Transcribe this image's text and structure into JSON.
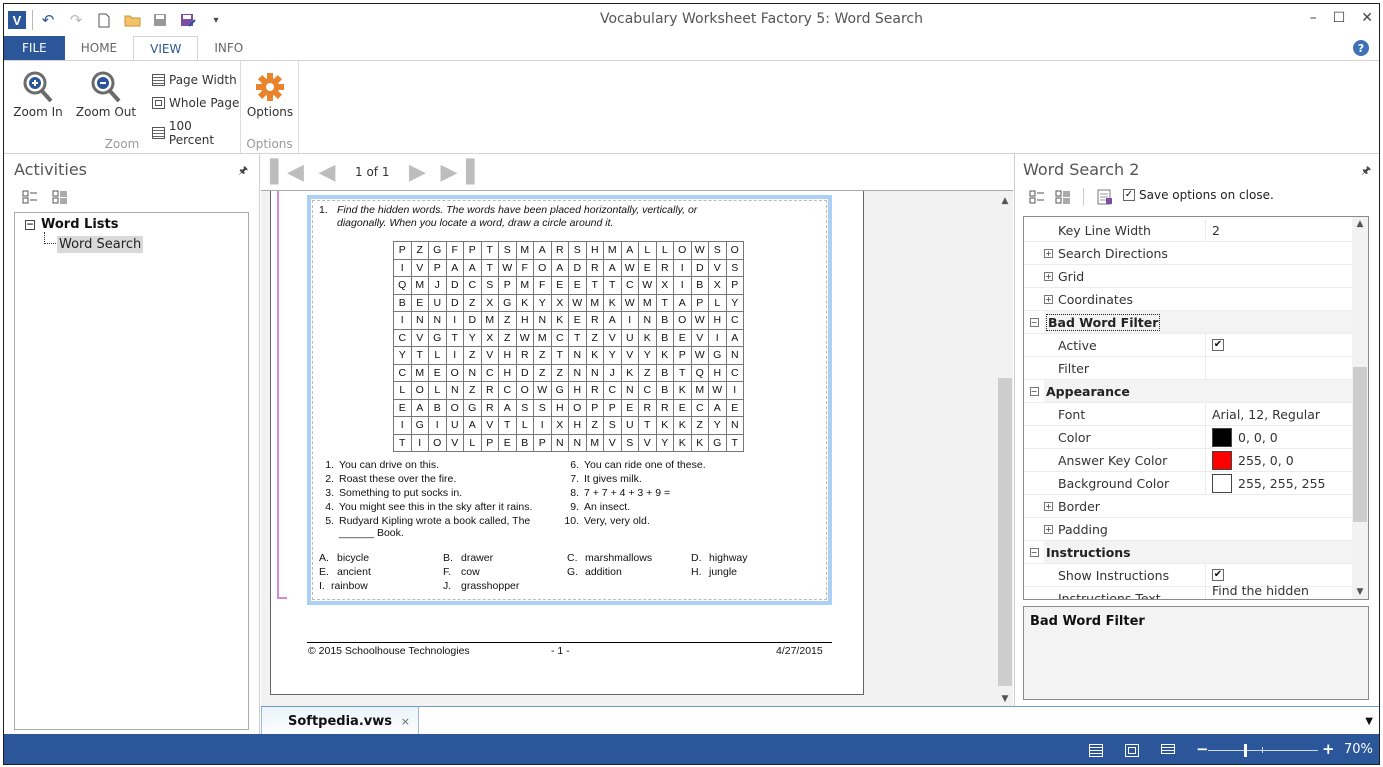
{
  "window": {
    "title": "Vocabulary Worksheet Factory 5: Word Search",
    "logo_letter": "V",
    "controls": {
      "minimize": "–",
      "maximize": "☐",
      "close": "✕"
    },
    "help": "?"
  },
  "quick_access": [
    "undo-icon",
    "redo-icon",
    "new-document-icon",
    "open-folder-icon",
    "save-icon",
    "save-as-icon",
    "customize-dropdown-icon"
  ],
  "ribbon": {
    "tabs": [
      {
        "label": "FILE"
      },
      {
        "label": "HOME"
      },
      {
        "label": "VIEW",
        "active": true
      },
      {
        "label": "INFO"
      }
    ],
    "zoom_group": {
      "label": "Zoom",
      "zoom_in": "Zoom In",
      "zoom_out": "Zoom Out",
      "page_width": "Page Width",
      "whole_page": "Whole Page",
      "hundred_percent": "100 Percent"
    },
    "options_group": {
      "label": "Options",
      "options": "Options"
    }
  },
  "activities": {
    "title": "Activities",
    "tree": {
      "root": "Word Lists",
      "child": "Word Search"
    }
  },
  "document": {
    "page_indicator": "1 of 1",
    "instruction_number": "1.",
    "instruction_line1": "Find the hidden words. The words have been placed horizontally, vertically, or",
    "instruction_line2": "diagonally. When you locate a word, draw a circle around it.",
    "grid": [
      "PZGFPTSMARSHMALLOWSO",
      "IVPAATWFOADRAWERIDVS",
      "QMJDCSPMFEETTCWXIBXP",
      "BEUDZXGKYXWMKWMTAPLY",
      "INNIDMZHNKERAINBOWHC",
      "CVGTYXZWMCTZVUKBEVIA",
      "YTLIZVHRZTNKYVYKPWGN",
      "CMEONCHDZZNNJKZBTQHC",
      "LOLNZRCOWGHRCNCBKMWI",
      "EABOGRASSHOPPERRECAE",
      "IGIUAVTLIXHZSUTKKZYN",
      "TIOVLPEBPNNMVSVYKKGT"
    ],
    "clues": [
      {
        "n": "1.",
        "text": "You can drive on this."
      },
      {
        "n": "2.",
        "text": "Roast these over the fire."
      },
      {
        "n": "3.",
        "text": "Something to put socks in."
      },
      {
        "n": "4.",
        "text": "You might see this in the sky after it rains."
      },
      {
        "n": "5.",
        "text": "Rudyard Kipling wrote a book called, The",
        "text2": "______ Book."
      },
      {
        "n": "6.",
        "text": "You can ride one of these."
      },
      {
        "n": "7.",
        "text": "It gives milk."
      },
      {
        "n": "8.",
        "text": "7 + 7 + 4 + 3 + 9 ="
      },
      {
        "n": "9.",
        "text": "An insect."
      },
      {
        "n": "10.",
        "text": "Very, very old."
      }
    ],
    "answers": [
      {
        "l": "A.",
        "w": "bicycle"
      },
      {
        "l": "B.",
        "w": "drawer"
      },
      {
        "l": "C.",
        "w": "marshmallows"
      },
      {
        "l": "D.",
        "w": "highway"
      },
      {
        "l": "E.",
        "w": "ancient"
      },
      {
        "l": "F.",
        "w": "cow"
      },
      {
        "l": "G.",
        "w": "addition"
      },
      {
        "l": "H.",
        "w": "jungle"
      },
      {
        "l": "I.",
        "w": "rainbow"
      },
      {
        "l": "J.",
        "w": "grasshopper"
      }
    ],
    "footer": {
      "copyright": "© 2015 Schoolhouse Technologies",
      "page": "- 1 -",
      "date": "4/27/2015"
    }
  },
  "properties": {
    "title": "Word Search 2",
    "save_options_label": "Save options on close.",
    "save_options_checked": true,
    "rows": [
      {
        "type": "prop",
        "name": "Key Line Width",
        "value": "2"
      },
      {
        "type": "sub",
        "name": "Search Directions"
      },
      {
        "type": "sub",
        "name": "Grid"
      },
      {
        "type": "sub",
        "name": "Coordinates"
      },
      {
        "type": "cat",
        "name": "Bad Word Filter",
        "focused": true
      },
      {
        "type": "prop",
        "name": "Active",
        "checkbox": true
      },
      {
        "type": "prop",
        "name": "Filter",
        "value": ""
      },
      {
        "type": "cat",
        "name": "Appearance"
      },
      {
        "type": "prop",
        "name": "Font",
        "value": "Arial, 12, Regular"
      },
      {
        "type": "prop",
        "name": "Color",
        "value": "0, 0, 0",
        "swatch": "#000000"
      },
      {
        "type": "prop",
        "name": "Answer Key Color",
        "value": "255, 0, 0",
        "swatch": "#ff0000"
      },
      {
        "type": "prop",
        "name": "Background Color",
        "value": "255, 255, 255",
        "swatch": "#ffffff"
      },
      {
        "type": "sub",
        "name": "Border"
      },
      {
        "type": "sub",
        "name": "Padding"
      },
      {
        "type": "cat",
        "name": "Instructions"
      },
      {
        "type": "prop",
        "name": "Show Instructions",
        "checkbox": true
      },
      {
        "type": "prop",
        "name": "Instructions Text",
        "value": "Find the hidden words."
      }
    ],
    "description_title": "Bad Word Filter"
  },
  "doc_tab": {
    "label": "Softpedia.vws",
    "close": "×"
  },
  "status": {
    "zoom_percent": 70,
    "zoom_label": "70%"
  },
  "colors": {
    "brand": "#2b579a",
    "accent_orange": "#e8842c"
  }
}
